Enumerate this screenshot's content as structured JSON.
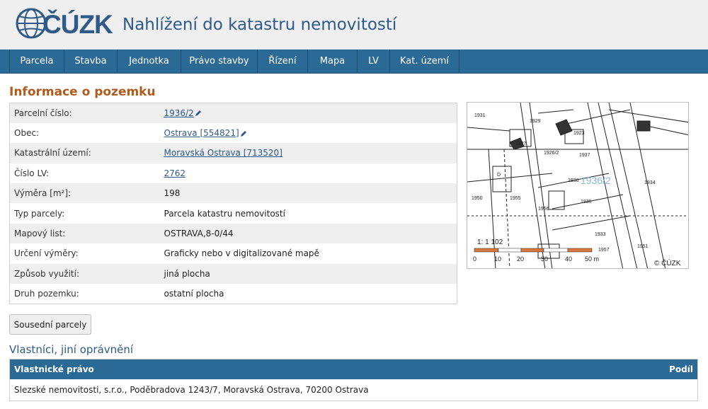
{
  "header": {
    "logo_text": "ČÚZK",
    "site_title": "Nahlížení do katastru nemovitostí"
  },
  "nav": {
    "items": [
      {
        "label": "Parcela"
      },
      {
        "label": "Stavba"
      },
      {
        "label": "Jednotka"
      },
      {
        "label": "Právo stavby"
      },
      {
        "label": "Řízení"
      },
      {
        "label": "Mapa"
      },
      {
        "label": "LV"
      },
      {
        "label": "Kat. území"
      }
    ]
  },
  "parcel": {
    "section_title": "Informace o pozemku",
    "rows": [
      {
        "label": "Parcelní číslo:",
        "value": "1936/2",
        "link": true,
        "edit_icon": true
      },
      {
        "label": "Obec:",
        "value": "Ostrava [554821]",
        "link": true,
        "edit_icon": true
      },
      {
        "label": "Katastrální území:",
        "value": "Moravská Ostrava [713520]",
        "link": true,
        "edit_icon": false
      },
      {
        "label": "Číslo LV:",
        "value": "2762",
        "link": true,
        "edit_icon": false
      },
      {
        "label": "Výměra [m²]:",
        "value": "198",
        "link": false,
        "edit_icon": false
      },
      {
        "label": "Typ parcely:",
        "value": "Parcela katastru nemovitostí",
        "link": false,
        "edit_icon": false
      },
      {
        "label": "Mapový list:",
        "value": "OSTRAVA,8-0/44",
        "link": false,
        "edit_icon": false
      },
      {
        "label": "Určení výměry:",
        "value": "Graficky nebo v digitalizované mapě",
        "link": false,
        "edit_icon": false
      },
      {
        "label": "Způsob využití:",
        "value": "jiná plocha",
        "link": false,
        "edit_icon": false
      },
      {
        "label": "Druh pozemku:",
        "value": "ostatní plocha",
        "link": false,
        "edit_icon": false
      }
    ]
  },
  "map": {
    "parcel_label": "1936/2",
    "scale_text": "1: 1 102",
    "scale_ticks": [
      "0",
      "10",
      "20",
      "30",
      "40",
      "50 m"
    ],
    "copyright": "© ČÚZK",
    "parcel_numbers": [
      "1931",
      "1929",
      "1923",
      "1927",
      "1926/2",
      "1937",
      "1935",
      "1936",
      "1956",
      "1955",
      "1933",
      "1934",
      "1932",
      "1960",
      "1957",
      "1958",
      "1959",
      "1950",
      "1951"
    ]
  },
  "neighbors_button": "Sousední parcely",
  "owners": {
    "title": "Vlastníci, jiní oprávnění",
    "col_right": "Vlastnické právo",
    "col_share": "Podíl",
    "rows": [
      {
        "text": "Slezské nemovitosti, s.r.o., Poděbradova 1243/7, Moravská Ostrava, 70200 Ostrava"
      }
    ]
  },
  "colors": {
    "nav_bg": "#2c6a96",
    "title_orange": "#b05a1c",
    "link_blue": "#2e5a8a",
    "header_bg": "#efefef"
  }
}
